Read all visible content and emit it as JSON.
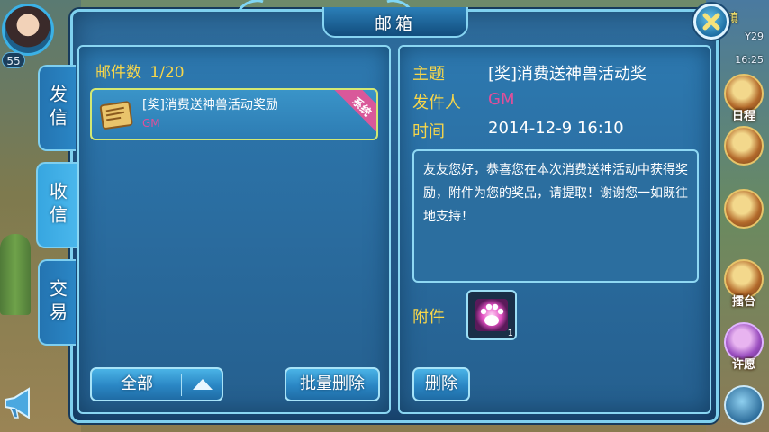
{
  "window": {
    "title": "邮箱"
  },
  "hud": {
    "level": "55",
    "coords": "Y29",
    "place": "镇",
    "time": "16:25",
    "buttons": [
      "日程",
      "擂台",
      "许愿"
    ]
  },
  "tabs": [
    "发信",
    "收信",
    "交易"
  ],
  "inbox": {
    "count_label": "邮件数",
    "count_value": "1/20",
    "mails": [
      {
        "subject": "[奖]消费送神兽活动奖励",
        "sender": "GM",
        "badge": "系统"
      }
    ],
    "filter_button": "全部",
    "batch_delete_button": "批量删除"
  },
  "detail": {
    "subject_label": "主题",
    "subject_value": "[奖]消费送神兽活动奖",
    "sender_label": "发件人",
    "sender_value": "GM",
    "time_label": "时间",
    "time_value": "2014-12-9 16:10",
    "body": "友友您好，恭喜您在本次消费送神活动中获得奖励，附件为您的奖品，请提取！谢谢您一如既往地支持！",
    "attachment_label": "附件",
    "attachment_count": "1",
    "delete_button": "删除"
  }
}
